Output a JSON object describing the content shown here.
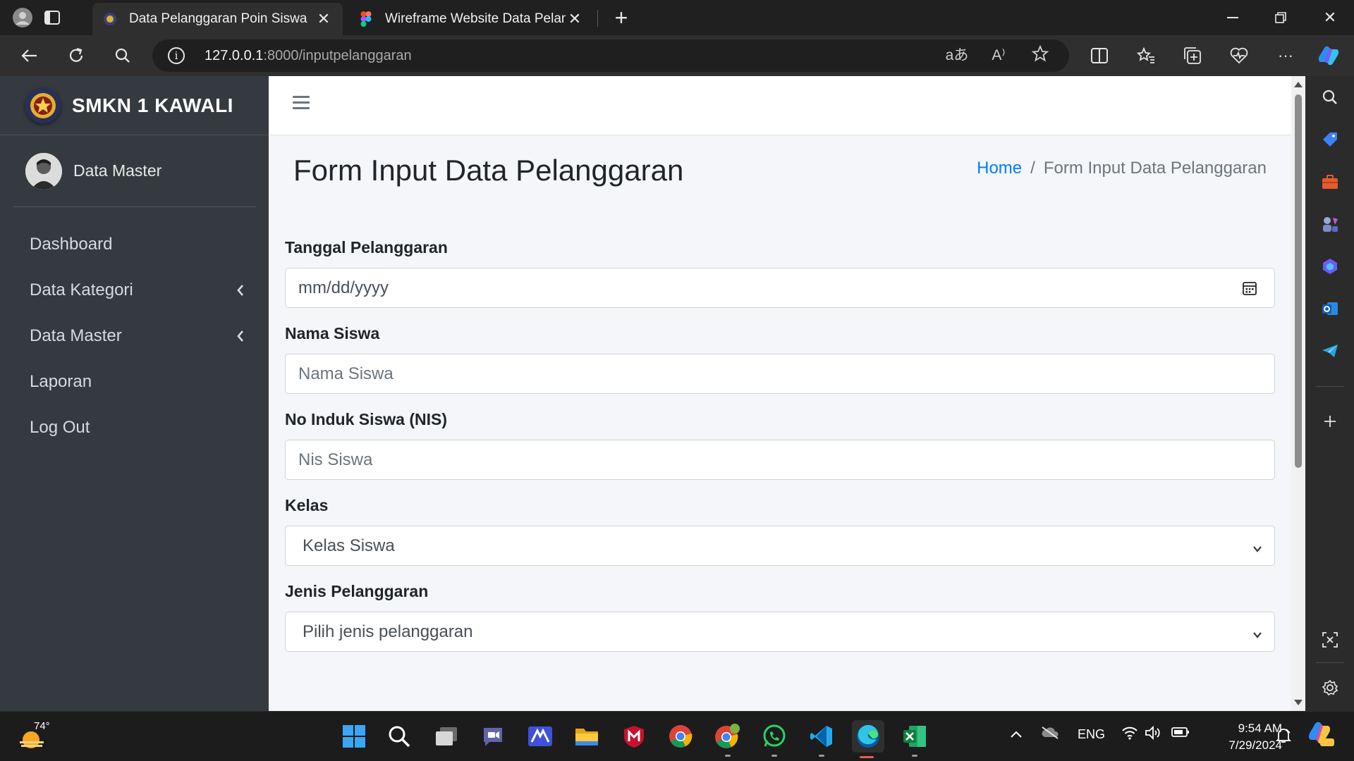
{
  "browser": {
    "tabs": [
      {
        "title": "Data Pelanggaran Poin Siswa",
        "active": true
      },
      {
        "title": "Wireframe Website Data Pelanggaran",
        "active": false
      }
    ],
    "url_host": "127.0.0.1",
    "url_path": ":8000/inputpelanggaran",
    "translate_glyph": "aあ",
    "read_aloud_glyph": "A⁾"
  },
  "sidebar": {
    "brand": "SMKN 1 KAWALI",
    "user": "Data Master",
    "items": [
      {
        "label": "Dashboard",
        "has_submenu": false
      },
      {
        "label": "Data Kategori",
        "has_submenu": true
      },
      {
        "label": "Data Master",
        "has_submenu": true
      },
      {
        "label": "Laporan",
        "has_submenu": false
      },
      {
        "label": "Log Out",
        "has_submenu": false
      }
    ]
  },
  "page": {
    "title": "Form Input Data Pelanggaran",
    "breadcrumb": {
      "home": "Home",
      "separator": "/",
      "current": "Form Input Data Pelanggaran"
    }
  },
  "form": {
    "tanggal": {
      "label": "Tanggal Pelanggaran",
      "placeholder": "mm/dd/yyyy"
    },
    "nama": {
      "label": "Nama Siswa",
      "placeholder": "Nama Siswa"
    },
    "nis": {
      "label": "No Induk Siswa (NIS)",
      "placeholder": "Nis Siswa"
    },
    "kelas": {
      "label": "Kelas",
      "selected": "Kelas Siswa"
    },
    "jenis": {
      "label": "Jenis Pelanggaran",
      "selected": "Pilih jenis pelanggaran"
    }
  },
  "taskbar": {
    "weather_temp": "74°",
    "language": "ENG",
    "time": "9:54 AM",
    "date": "7/29/2024"
  },
  "colors": {
    "sidebar_bg": "#343a40",
    "content_bg": "#f4f6f9",
    "link": "#007bff",
    "browser_chrome": "#202020"
  },
  "icons": [
    "profile-icon",
    "tab-actions-icon",
    "back-icon",
    "refresh-icon",
    "search-icon",
    "info-icon",
    "translate-icon",
    "read-aloud-icon",
    "favorite-star-icon",
    "split-screen-icon",
    "favorites-icon",
    "collections-icon",
    "health-icon",
    "more-icon",
    "copilot-icon",
    "hamburger-icon",
    "calendar-icon",
    "chevron-left-icon",
    "chevron-down-icon"
  ]
}
